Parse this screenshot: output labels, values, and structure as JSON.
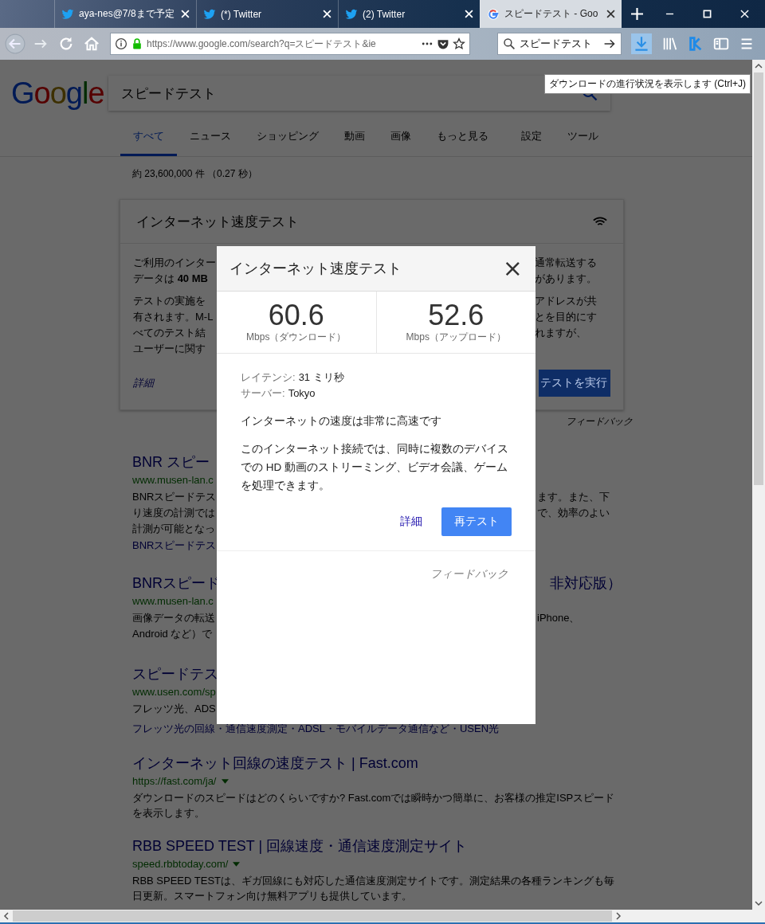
{
  "browser": {
    "tabs": [
      {
        "title": "aya-nes@7/8まで予定",
        "kind": "bird",
        "selected": false
      },
      {
        "title": "(*) Twitter",
        "kind": "bird",
        "selected": false
      },
      {
        "title": "(2) Twitter",
        "kind": "bird",
        "selected": false
      },
      {
        "title": "スピードテスト - Goo",
        "kind": "g",
        "selected": true
      }
    ],
    "url": "https://www.google.com/search?q=スピードテスト&ie",
    "search": "スピードテスト",
    "tooltip": "ダウンロードの進行状況を表示します (Ctrl+J)"
  },
  "page": {
    "logo": "Google",
    "query": "スピードテスト",
    "nav": [
      {
        "label": "すべて",
        "selected": true
      },
      {
        "label": "ニュース",
        "selected": false
      },
      {
        "label": "ショッピング",
        "selected": false
      },
      {
        "label": "動画",
        "selected": false
      },
      {
        "label": "画像",
        "selected": false
      },
      {
        "label": "もっと見る",
        "selected": false
      }
    ],
    "nav_right": [
      "設定",
      "ツール"
    ],
    "stats": "約 23,600,000 件 （0.27 秒）",
    "card": {
      "title": "インターネット速度テスト",
      "paragraphs": [
        [
          {
            "left": "ご利用のインター",
            "right": "通常転送する"
          },
          {
            "left": "データは **40 MB**",
            "right": "があります。"
          }
        ],
        [
          {
            "left": "テストの実施を",
            "right": "アドレスが共"
          },
          {
            "left": "有されます。M-L",
            "right": "とを目的にす"
          },
          {
            "left": "べてのテスト結",
            "right": "れますが、"
          },
          {
            "left": "ユーザーに関す"
          }
        ]
      ],
      "link": "詳細",
      "button": "テストを実行",
      "feedback": "フィードバック"
    },
    "results": [
      {
        "title": "BNR スピー",
        "url": "www.musen-lan.c",
        "menu": false,
        "lines": [
          {
            "left": "BNRスピードテス",
            "right": "ます。また、下"
          },
          {
            "left": "り速度の計測では",
            "right": "で、効率のよい"
          },
          {
            "left": "計測が可能となっ"
          }
        ],
        "sitelinks": "BNRスピードテス"
      },
      {
        "title": "BNRスピード",
        "title_right": "非対応版）",
        "url": "www.musen-lan.c",
        "menu": false,
        "lines": [
          {
            "left": "画像データの転送",
            "right": "iPhone、"
          },
          {
            "left": "Android など）で"
          }
        ]
      },
      {
        "title": "スピードテス",
        "url": "www.usen.com/sp",
        "menu": false,
        "lines": [
          {
            "left": "フレッツ光、ADS"
          }
        ],
        "sitelinks": "フレッツ光の回線・通信速度測定・ADSL・モバイルデータ通信など・USEN光"
      },
      {
        "title": "インターネット回線の速度テスト | Fast.com",
        "url": "https://fast.com/ja/",
        "menu": true,
        "snippet": "ダウンロードのスピードはどのくらいですか? Fast.comでは瞬時かつ簡単に、お客様の推定ISPスピードを表示します。"
      },
      {
        "title": "RBB SPEED TEST | 回線速度・通信速度測定サイト",
        "url": "speed.rbbtoday.com/",
        "menu": true,
        "snippet": "RBB SPEED TESTは、ギガ回線にも対応した通信速度測定サイトです。測定結果の各種ランキングも毎日更新。スマートフォン向け無料アプリも提供しています。"
      }
    ]
  },
  "dialog": {
    "title": "インターネット速度テスト",
    "close": "×",
    "speeds": [
      {
        "value": "60.6",
        "unit": "Mbps（ダウンロード）"
      },
      {
        "value": "52.6",
        "unit": "Mbps（アップロード）"
      }
    ],
    "details": [
      {
        "label": "レイテンシ:",
        "value": "31 ミリ秒"
      },
      {
        "label": "サーバー:",
        "value": "Tokyo"
      }
    ],
    "verdict": "インターネットの速度は非常に高速です",
    "description": "このインターネット接続では、同時に複数のデバイスでの HD 動画のストリーミング、ビデオ会議、ゲームを処理できます。",
    "link": "詳細",
    "button": "再テスト",
    "feedback": "フィードバック"
  }
}
